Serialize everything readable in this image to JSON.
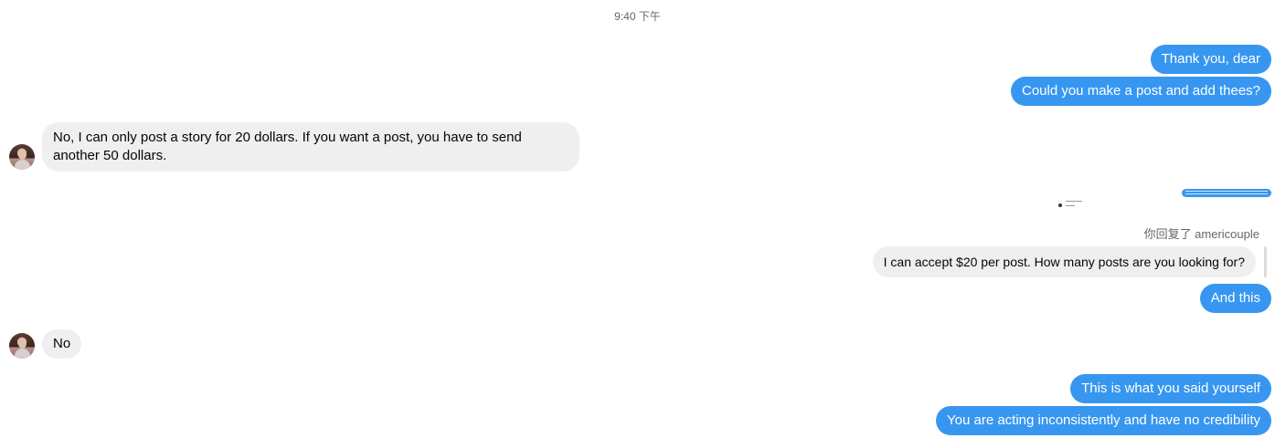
{
  "timestamp": "9:40 下午",
  "messages": {
    "out_1": "Thank you, dear",
    "out_2": "Could you make a post and add thees?",
    "in_1": "No, I can only post a story for 20 dollars. If you want a post, you have to send another 50 dollars.",
    "reply_label": "你回复了 americouple",
    "reply_quote": "I can accept $20 per post. How many posts are you looking for?",
    "out_3": "And this",
    "in_2": "No",
    "out_4": "This is what you said yourself",
    "out_5": "You are acting inconsistently and have no credibility"
  },
  "colors": {
    "outgoing_bubble": "#3797f0",
    "incoming_bubble": "#efefef"
  },
  "icons": {
    "avatar": "contact-avatar"
  }
}
